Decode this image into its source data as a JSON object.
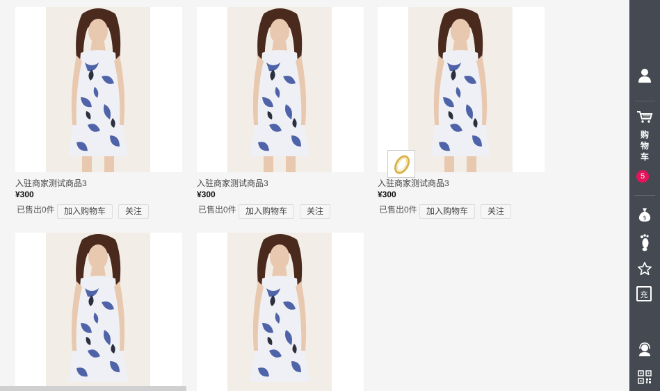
{
  "products": [
    {
      "name": "入驻商家测试商品3",
      "price": "¥300",
      "sold": "已售出0件",
      "add_cart": "加入购物车",
      "follow": "关注"
    },
    {
      "name": "入驻商家测试商品3",
      "price": "¥300",
      "sold": "已售出0件",
      "add_cart": "加入购物车",
      "follow": "关注"
    },
    {
      "name": "入驻商家测试商品3",
      "price": "¥300",
      "sold": "已售出0件",
      "add_cart": "加入购物车",
      "follow": "关注"
    },
    {
      "name": "",
      "price": "",
      "sold": "",
      "add_cart": "",
      "follow": ""
    },
    {
      "name": "",
      "price": "",
      "sold": "",
      "add_cart": "",
      "follow": ""
    }
  ],
  "sidebar": {
    "cart_chars": [
      "购",
      "物",
      "车"
    ],
    "cart_count": "5",
    "charge_label": "充",
    "icons": [
      "user-icon",
      "cart-icon",
      "money-bag-icon",
      "footprint-icon",
      "star-icon",
      "charge-icon",
      "customer-service-icon",
      "qrcode-icon"
    ],
    "background": "#454a52",
    "badge_color": "#e4145a"
  }
}
